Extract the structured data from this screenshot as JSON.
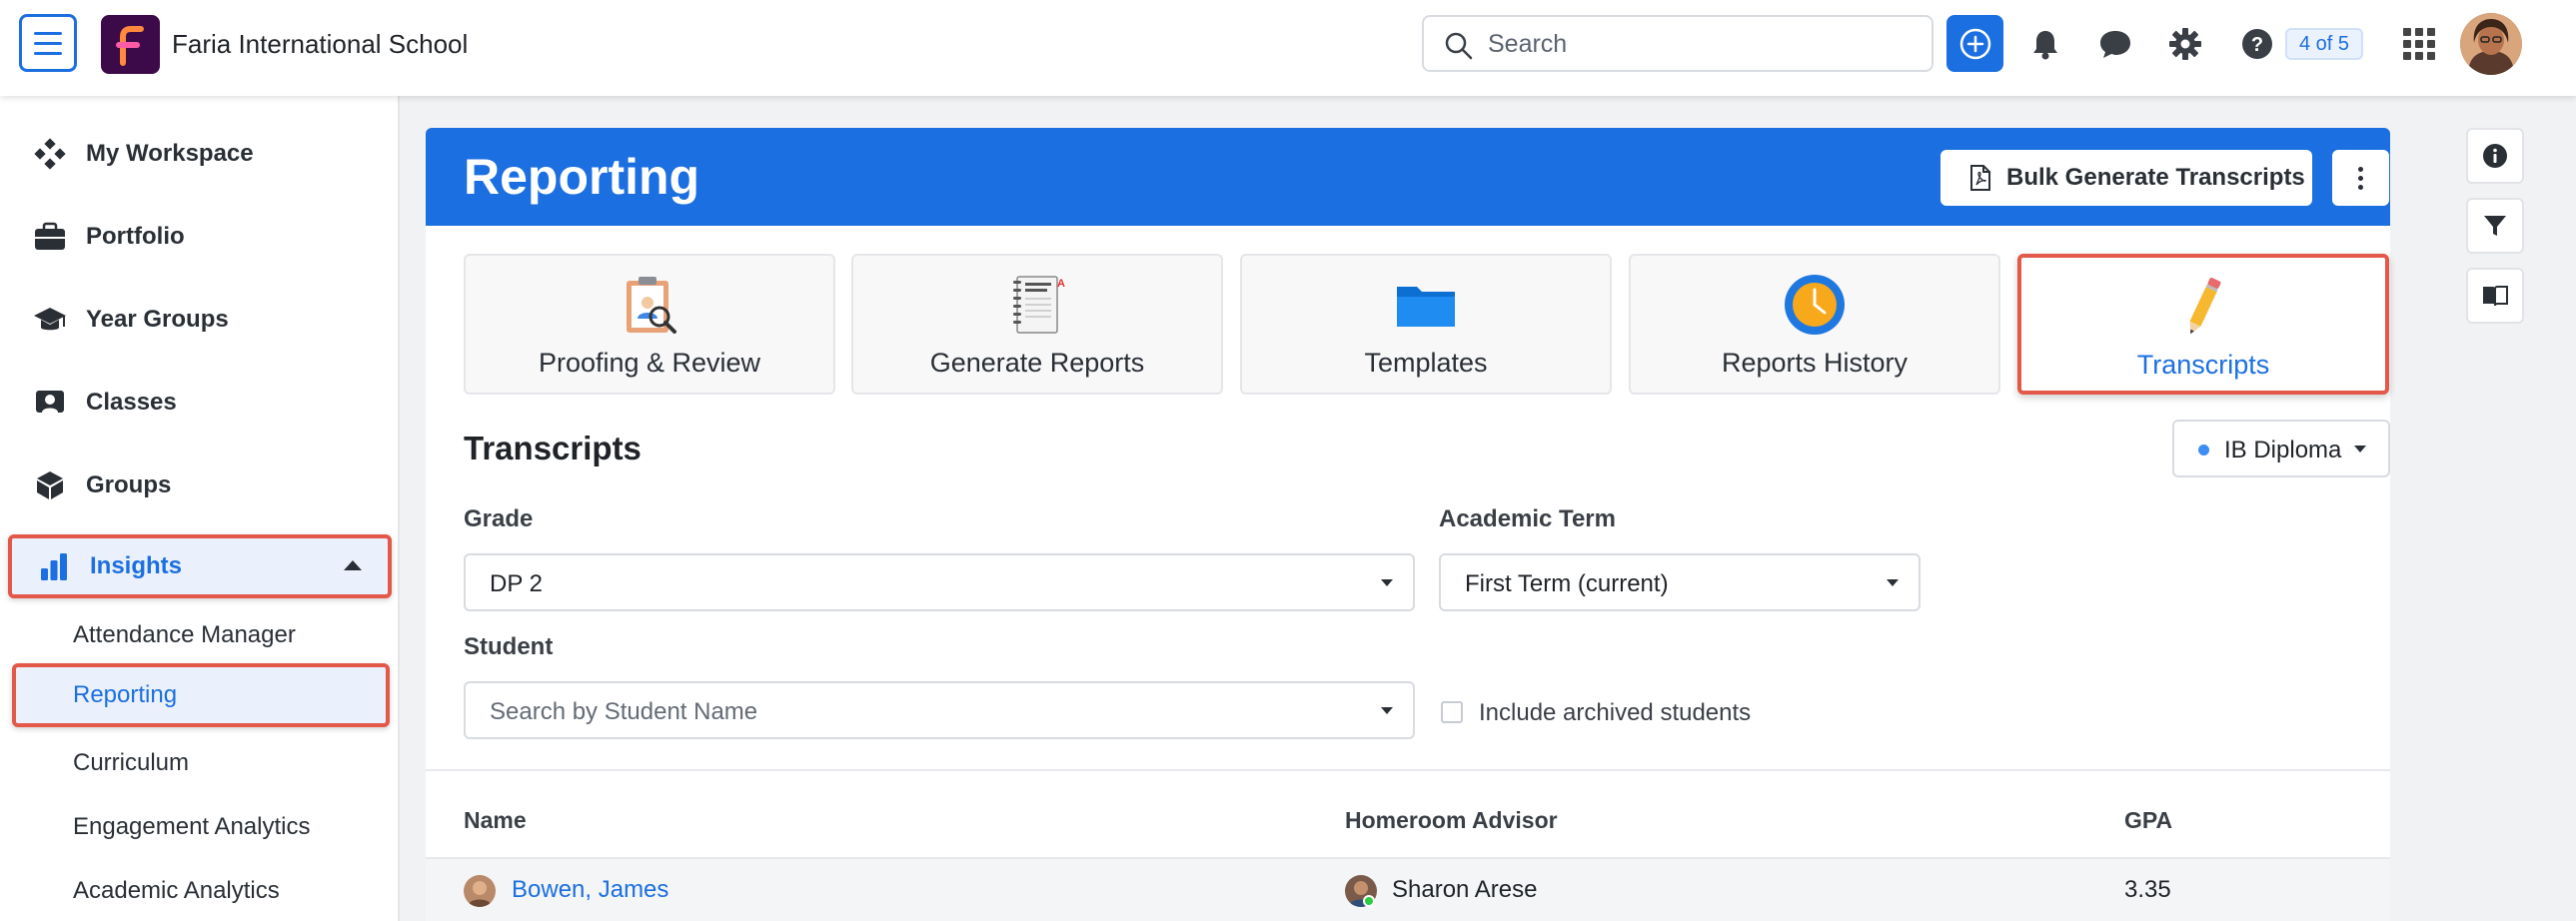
{
  "header": {
    "school_name": "Faria International School",
    "search_placeholder": "Search",
    "page_counter": "4 of 5"
  },
  "sidebar": {
    "items": [
      {
        "label": "My Workspace",
        "icon": "workspace-icon"
      },
      {
        "label": "Portfolio",
        "icon": "briefcase-icon"
      },
      {
        "label": "Year Groups",
        "icon": "graduation-cap-icon"
      },
      {
        "label": "Classes",
        "icon": "classes-icon"
      },
      {
        "label": "Groups",
        "icon": "cube-icon"
      },
      {
        "label": "Insights",
        "icon": "bar-chart-icon",
        "expanded": true
      }
    ],
    "sub_items": [
      {
        "label": "Attendance Manager"
      },
      {
        "label": "Reporting",
        "active": true
      },
      {
        "label": "Curriculum"
      },
      {
        "label": "Engagement Analytics"
      },
      {
        "label": "Academic Analytics"
      }
    ]
  },
  "main": {
    "title": "Reporting",
    "bulk_button": "Bulk Generate Transcripts",
    "tiles": [
      {
        "label": "Proofing & Review",
        "icon": "proofing-clipboard-icon"
      },
      {
        "label": "Generate Reports",
        "icon": "report-cards-notebook-icon"
      },
      {
        "label": "Templates",
        "icon": "folder-icon"
      },
      {
        "label": "Reports History",
        "icon": "clock-icon"
      },
      {
        "label": "Transcripts",
        "icon": "pencil-icon",
        "active": true
      }
    ],
    "section_title": "Transcripts",
    "program": "IB Diploma",
    "grade_label": "Grade",
    "grade_value": "DP 2",
    "term_label": "Academic Term",
    "term_value": "First Term (current)",
    "student_label": "Student",
    "student_placeholder": "Search by Student Name",
    "archived_label": "Include archived students",
    "archived_checked": false,
    "table": {
      "headers": [
        "Name",
        "Homeroom Advisor",
        "GPA"
      ],
      "rows": [
        {
          "name": "Bowen, James",
          "advisor": "Sharon Arese",
          "gpa": "3.35"
        }
      ]
    }
  },
  "colors": {
    "primary": "#1c6fe0",
    "highlight": "#e45849",
    "logo_bg": "#3c0a49"
  }
}
